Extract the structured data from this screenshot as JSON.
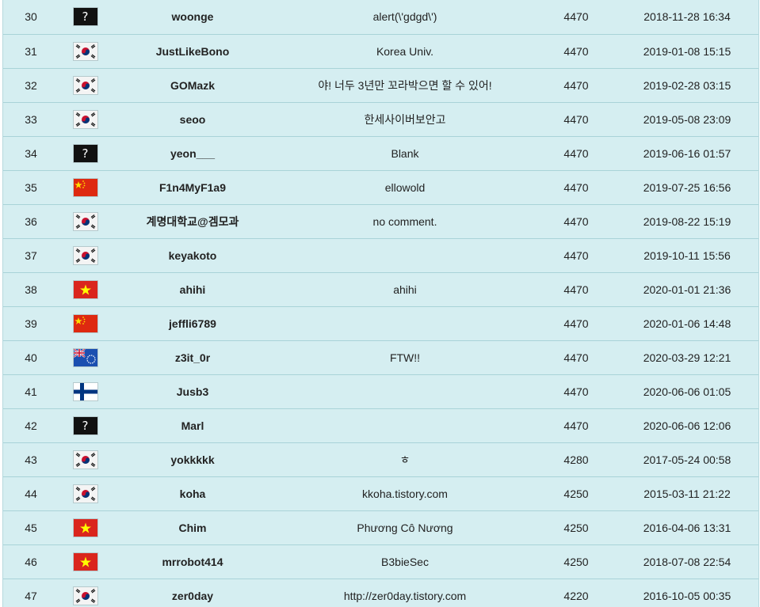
{
  "rows": [
    {
      "rank": "30",
      "flag": "unknown",
      "name": "woonge",
      "comment": "alert(\\'gdgd\\')",
      "score": "4470",
      "date": "2018-11-28 16:34"
    },
    {
      "rank": "31",
      "flag": "south-korea",
      "name": "JustLikeBono",
      "comment": "Korea Univ.",
      "score": "4470",
      "date": "2019-01-08 15:15"
    },
    {
      "rank": "32",
      "flag": "south-korea",
      "name": "GOMazk",
      "comment": "야! 너두 3년만 꼬라박으면 할 수 있어!",
      "score": "4470",
      "date": "2019-02-28 03:15"
    },
    {
      "rank": "33",
      "flag": "south-korea",
      "name": "seoo",
      "comment": "한세사이버보안고",
      "score": "4470",
      "date": "2019-05-08 23:09"
    },
    {
      "rank": "34",
      "flag": "unknown",
      "name": "yeon___",
      "comment": "Blank",
      "score": "4470",
      "date": "2019-06-16 01:57"
    },
    {
      "rank": "35",
      "flag": "china",
      "name": "F1n4MyF1a9",
      "comment": "ellowold",
      "score": "4470",
      "date": "2019-07-25 16:56"
    },
    {
      "rank": "36",
      "flag": "south-korea",
      "name": "계명대학교@겜모과",
      "comment": "no comment.",
      "score": "4470",
      "date": "2019-08-22 15:19"
    },
    {
      "rank": "37",
      "flag": "south-korea",
      "name": "keyakoto",
      "comment": "",
      "score": "4470",
      "date": "2019-10-11 15:56"
    },
    {
      "rank": "38",
      "flag": "vietnam",
      "name": "ahihi",
      "comment": "ahihi",
      "score": "4470",
      "date": "2020-01-01 21:36"
    },
    {
      "rank": "39",
      "flag": "china",
      "name": "jeffli6789",
      "comment": "",
      "score": "4470",
      "date": "2020-01-06 14:48"
    },
    {
      "rank": "40",
      "flag": "cook-islands",
      "name": "z3it_0r",
      "comment": "FTW!!",
      "score": "4470",
      "date": "2020-03-29 12:21"
    },
    {
      "rank": "41",
      "flag": "finland",
      "name": "Jusb3",
      "comment": "",
      "score": "4470",
      "date": "2020-06-06 01:05"
    },
    {
      "rank": "42",
      "flag": "unknown",
      "name": "Marl",
      "comment": "",
      "score": "4470",
      "date": "2020-06-06 12:06"
    },
    {
      "rank": "43",
      "flag": "south-korea",
      "name": "yokkkkk",
      "comment": "ㅎ",
      "score": "4280",
      "date": "2017-05-24 00:58"
    },
    {
      "rank": "44",
      "flag": "south-korea",
      "name": "koha",
      "comment": "kkoha.tistory.com",
      "score": "4250",
      "date": "2015-03-11 21:22"
    },
    {
      "rank": "45",
      "flag": "vietnam",
      "name": "Chim",
      "comment": "Phương Cô Nương",
      "score": "4250",
      "date": "2016-04-06 13:31"
    },
    {
      "rank": "46",
      "flag": "vietnam",
      "name": "mrrobot414",
      "comment": "B3bieSec",
      "score": "4250",
      "date": "2018-07-08 22:54"
    },
    {
      "rank": "47",
      "flag": "south-korea",
      "name": "zer0day",
      "comment": "http://zer0day.tistory.com",
      "score": "4220",
      "date": "2016-10-05 00:35"
    }
  ],
  "unknown_flag_glyph": "?",
  "colors": {
    "background": "#d5eef1",
    "row_divider": "#a9d3d8",
    "text": "#222222"
  }
}
